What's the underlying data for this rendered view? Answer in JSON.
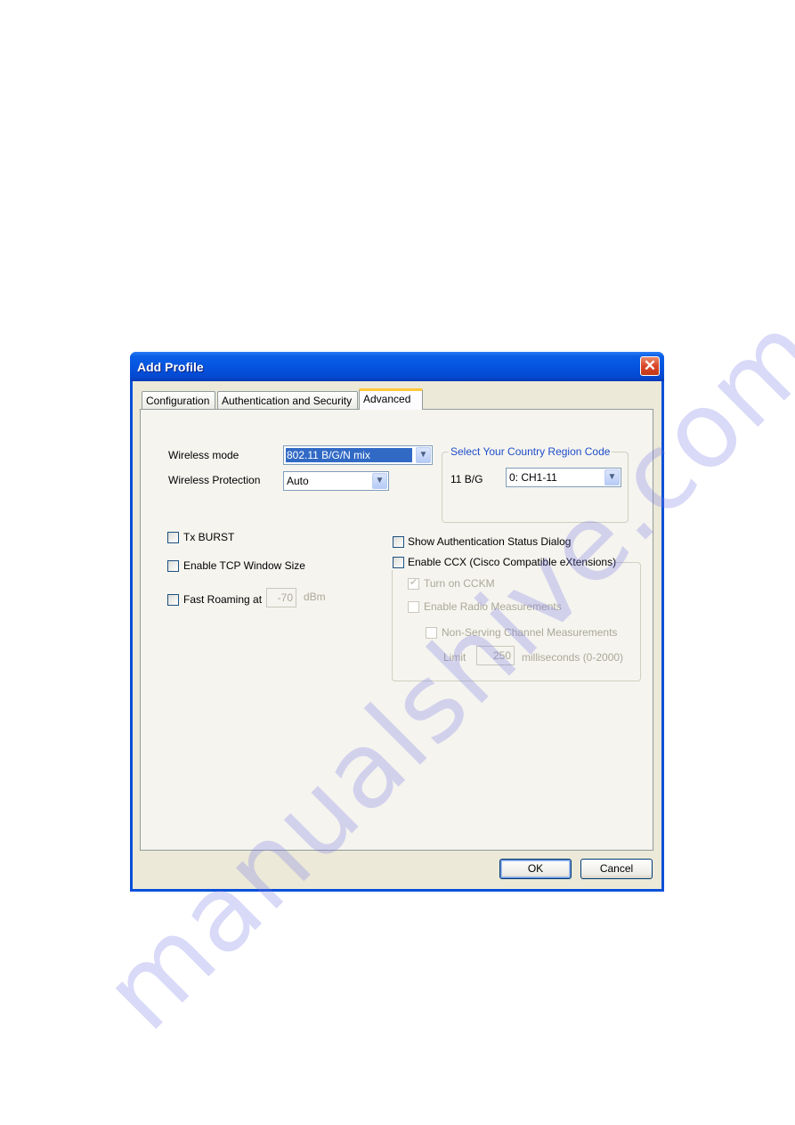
{
  "window": {
    "title": "Add Profile",
    "close_icon": "close-x-icon"
  },
  "tabs": [
    {
      "label": "Configuration",
      "active": false
    },
    {
      "label": "Authentication and Security",
      "active": false
    },
    {
      "label": "Advanced",
      "active": true
    }
  ],
  "advanced": {
    "wireless_mode": {
      "label": "Wireless mode",
      "value": "802.11 B/G/N mix"
    },
    "wireless_protection": {
      "label": "Wireless Protection",
      "value": "Auto"
    },
    "country_region": {
      "group_label": "Select Your Country Region Code",
      "band_label": "11 B/G",
      "value": "0: CH1-11"
    },
    "tx_burst": {
      "label": "Tx BURST",
      "checked": false
    },
    "tcp_window": {
      "label": "Enable TCP Window Size",
      "checked": false
    },
    "fast_roaming": {
      "label": "Fast Roaming at",
      "value": "-70",
      "unit": "dBm",
      "checked": false
    },
    "show_auth_status": {
      "label": "Show Authentication Status Dialog",
      "checked": false
    },
    "ccx": {
      "label": "Enable CCX (Cisco Compatible eXtensions)",
      "checked": false,
      "cckm": {
        "label": "Turn on CCKM",
        "checked": true,
        "enabled": false
      },
      "radio_measurements": {
        "label": "Enable Radio Measurements",
        "checked": false,
        "enabled": false
      },
      "non_serving": {
        "label": "Non-Serving Channel Measurements",
        "checked": false,
        "enabled": false
      },
      "limit": {
        "label": "Limit",
        "value": "250",
        "unit": "milliseconds (0-2000)"
      }
    }
  },
  "buttons": {
    "ok": "OK",
    "cancel": "Cancel"
  },
  "watermark": "manualshive.com"
}
